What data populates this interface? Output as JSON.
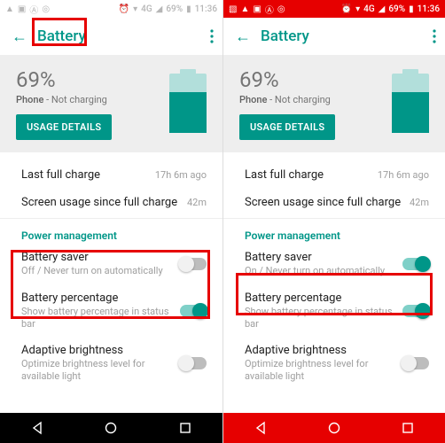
{
  "screens": [
    {
      "status": {
        "pct": "69%",
        "time": "11:36",
        "net": "4G"
      },
      "appbar": {
        "title": "Battery"
      },
      "hero": {
        "pct": "69%",
        "sub_bold": "Phone",
        "sub_rest": " - Not charging",
        "button": "USAGE DETAILS",
        "fill_pct": 69
      },
      "rows": {
        "last_charge": {
          "label": "Last full charge",
          "meta": "17h 6m ago"
        },
        "screen_usage": {
          "label": "Screen usage since full charge",
          "meta": "42m"
        },
        "section": "Power management",
        "battery_saver": {
          "label": "Battery saver",
          "sub": "Off / Never turn on automatically",
          "on": false
        },
        "battery_pct": {
          "label": "Battery percentage",
          "sub": "Show battery percentage in status bar",
          "on": true
        },
        "adaptive": {
          "label": "Adaptive brightness",
          "sub": "Optimize brightness level for available light",
          "on": false
        }
      }
    },
    {
      "status": {
        "pct": "69%",
        "time": "11:36",
        "net": "4G"
      },
      "appbar": {
        "title": "Battery"
      },
      "hero": {
        "pct": "69%",
        "sub_bold": "Phone",
        "sub_rest": " - Not charging",
        "button": "USAGE DETAILS",
        "fill_pct": 69
      },
      "rows": {
        "last_charge": {
          "label": "Last full charge",
          "meta": "17h 6m ago"
        },
        "screen_usage": {
          "label": "Screen usage since full charge",
          "meta": "42m"
        },
        "section": "Power management",
        "battery_saver": {
          "label": "Battery saver",
          "sub": "On / Never turn on automatically",
          "on": true
        },
        "battery_pct": {
          "label": "Battery percentage",
          "sub": "Show battery percentage in status bar",
          "on": true
        },
        "adaptive": {
          "label": "Adaptive brightness",
          "sub": "Optimize brightness level for available light",
          "on": false
        }
      }
    }
  ]
}
